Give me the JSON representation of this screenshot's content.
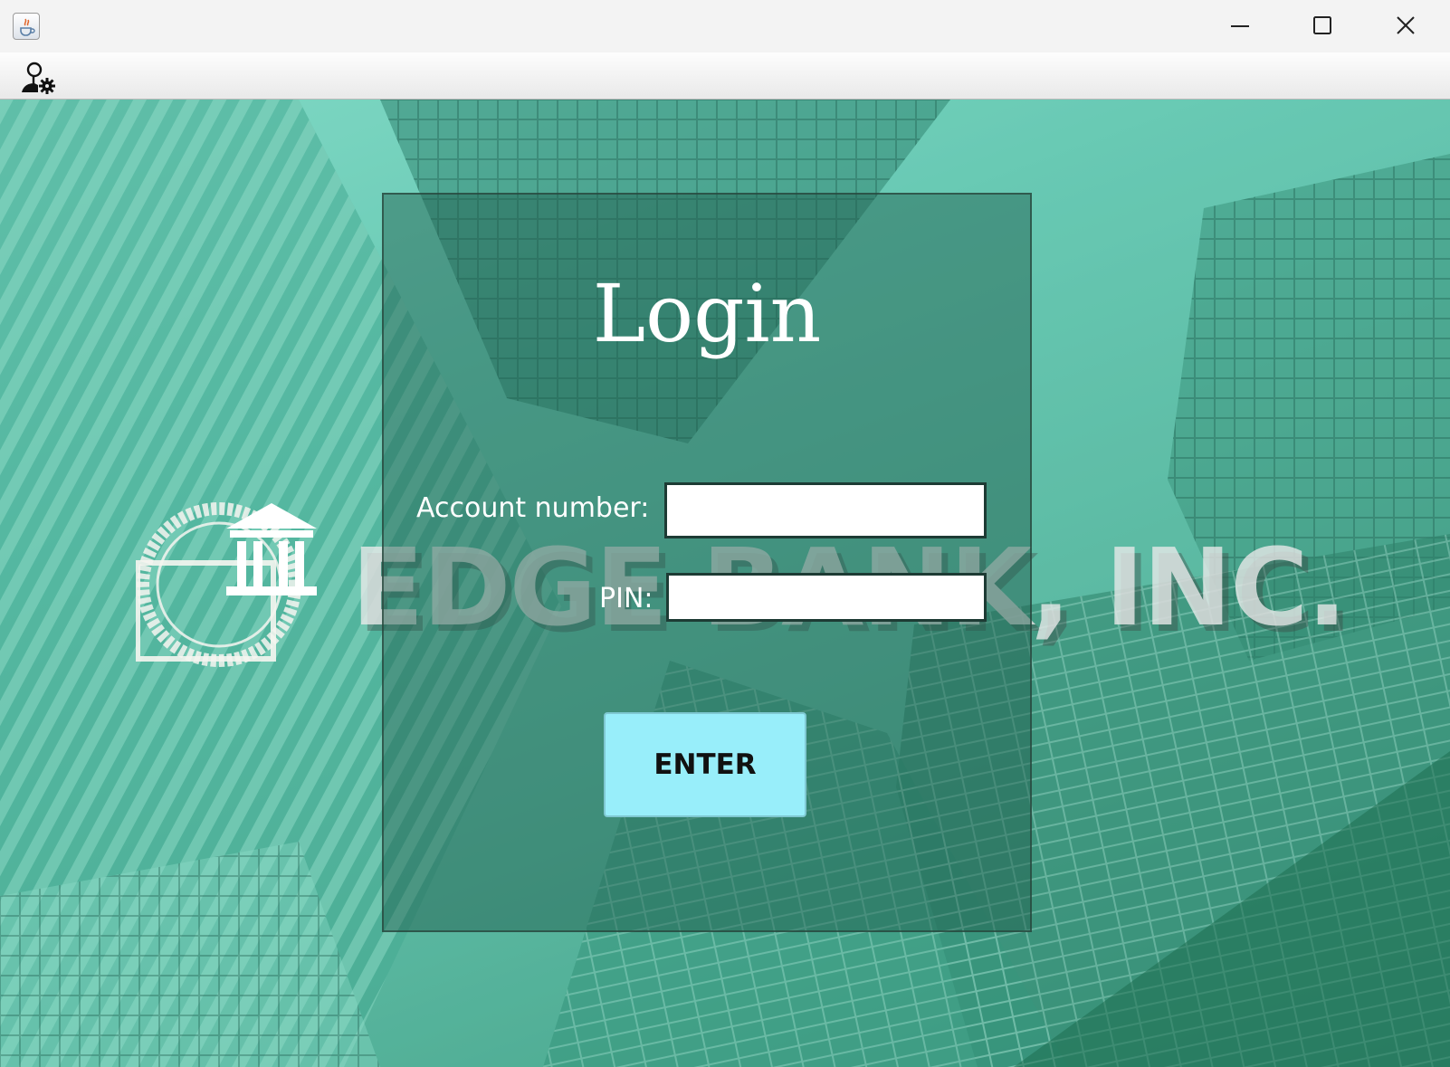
{
  "window": {
    "controls": {
      "minimize_icon": "minimize-icon",
      "maximize_icon": "maximize-icon",
      "close_icon": "close-icon"
    },
    "app_icon": "java-cup-icon"
  },
  "toolbar": {
    "user_settings_icon": "user-settings-icon"
  },
  "brand": {
    "name": "EDGE BANK, INC.",
    "emblem_icon": "bank-building-icon"
  },
  "login": {
    "title": "Login",
    "account_label": "Account number:",
    "account_value": "",
    "pin_label": "PIN:",
    "pin_value": "",
    "enter_label": "ENTER"
  },
  "colors": {
    "accent_teal": "#5fc3ad",
    "button_cyan": "#98eefa",
    "panel_overlay": "#1e5a4b"
  }
}
